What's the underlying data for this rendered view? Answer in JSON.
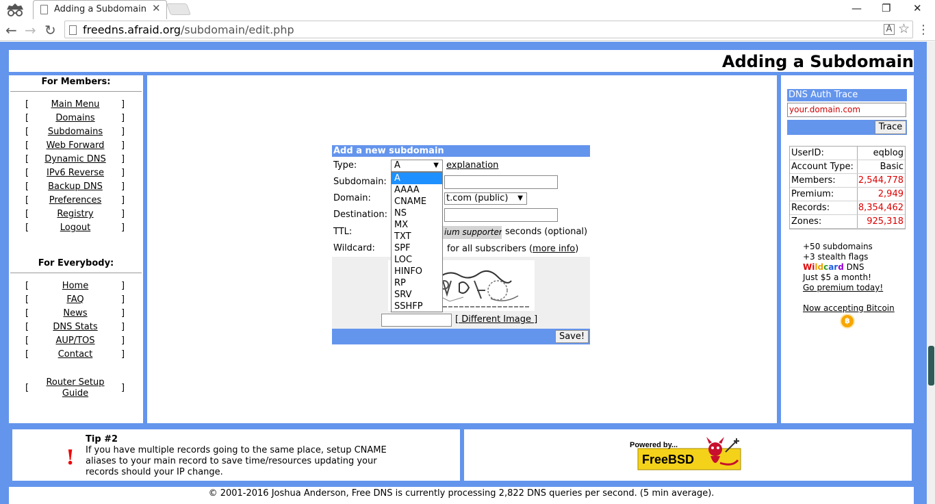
{
  "browser": {
    "tab_title": "Adding a Subdomain",
    "url_host": "freedns.afraid.org",
    "url_path": "/subdomain/edit.php"
  },
  "page": {
    "title": "Adding a Subdomain"
  },
  "members_nav": {
    "heading": "For Members:",
    "items": [
      "Main Menu",
      "Domains",
      "Subdomains",
      "Web Forward",
      "Dynamic DNS",
      "IPv6 Reverse",
      "Backup DNS",
      "Preferences",
      "Registry",
      "Logout"
    ]
  },
  "everybody_nav": {
    "heading": "For Everybody:",
    "items": [
      "Home",
      "FAQ",
      "News",
      "DNS Stats",
      "AUP/TOS",
      "Contact"
    ],
    "router_line1": "Router Setup",
    "router_line2": "Guide"
  },
  "form": {
    "heading": "Add a new subdomain",
    "type_label": "Type:",
    "type_value": "A",
    "explanation_link": "explanation",
    "subdomain_label": "Subdomain:",
    "domain_label": "Domain:",
    "domain_value": "t.com (public)",
    "destination_label": "Destination:",
    "ttl_label": "TTL:",
    "ttl_value": "ium supporters",
    "ttl_suffix": "seconds (optional)",
    "wildcard_label": "Wildcard:",
    "wildcard_text": "for all subscribers (",
    "more_info_link": "more info",
    "wildcard_close": ")",
    "different_image": "[ Different Image ]",
    "save_button": "Save!"
  },
  "type_options": [
    "A",
    "AAAA",
    "CNAME",
    "NS",
    "MX",
    "TXT",
    "SPF",
    "LOC",
    "HINFO",
    "RP",
    "SRV",
    "SSHFP"
  ],
  "trace": {
    "heading": "DNS Auth Trace",
    "input_value": "your.domain.com",
    "button": "Trace"
  },
  "stats": [
    {
      "label": "UserID:",
      "value": "eqblog",
      "red": false
    },
    {
      "label": "Account Type:",
      "value": "Basic",
      "red": false
    },
    {
      "label": "Members:",
      "value": "2,544,778",
      "red": true
    },
    {
      "label": "Premium:",
      "value": "2,949",
      "red": true
    },
    {
      "label": "Records:",
      "value": "8,354,462",
      "red": true
    },
    {
      "label": "Zones:",
      "value": "925,318",
      "red": true
    }
  ],
  "promo": {
    "line1": "+50 subdomains",
    "line2": "+3 stealth flags",
    "wild_1": "Wi",
    "wild_2": "ld",
    "wild_3": "c",
    "wild_4": "ar",
    "wild_5": "d",
    "dns": " DNS",
    "line4": "Just $5 a month!",
    "link": "Go premium today!",
    "bitcoin": "Now accepting Bitcoin",
    "bitcoin_symbol": "฿"
  },
  "tip": {
    "title": "Tip #2",
    "body": "If you have multiple records going to the same place, setup CNAME aliases to your main record to save time/resources updating your records should your IP change.",
    "icon": "!"
  },
  "badge": {
    "powered_by": "Powered by...",
    "name": "FreeBSD"
  },
  "copyright": "© 2001-2016 Joshua Anderson, Free DNS is currently processing 2,822 DNS queries per second. (5 min average)."
}
